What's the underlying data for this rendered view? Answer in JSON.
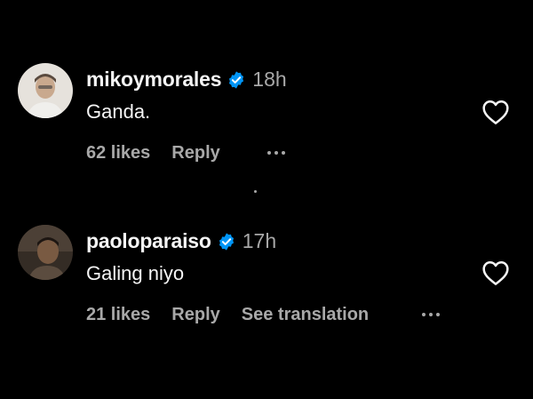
{
  "comments": [
    {
      "username": "mikoymorales",
      "time": "18h",
      "text": "Ganda.",
      "likes": "62 likes",
      "reply": "Reply"
    },
    {
      "username": "paoloparaiso",
      "time": "17h",
      "text": "Galing niyo",
      "likes": "21 likes",
      "reply": "Reply",
      "see_translation": "See translation"
    }
  ],
  "icons": {
    "verified": "verified-badge-icon",
    "heart": "heart-outline-icon",
    "more": "more-options-icon"
  },
  "colors": {
    "background": "#000000",
    "primary_text": "#f5f5f5",
    "secondary_text": "#a8a8a8",
    "verified_blue": "#0095f6"
  }
}
